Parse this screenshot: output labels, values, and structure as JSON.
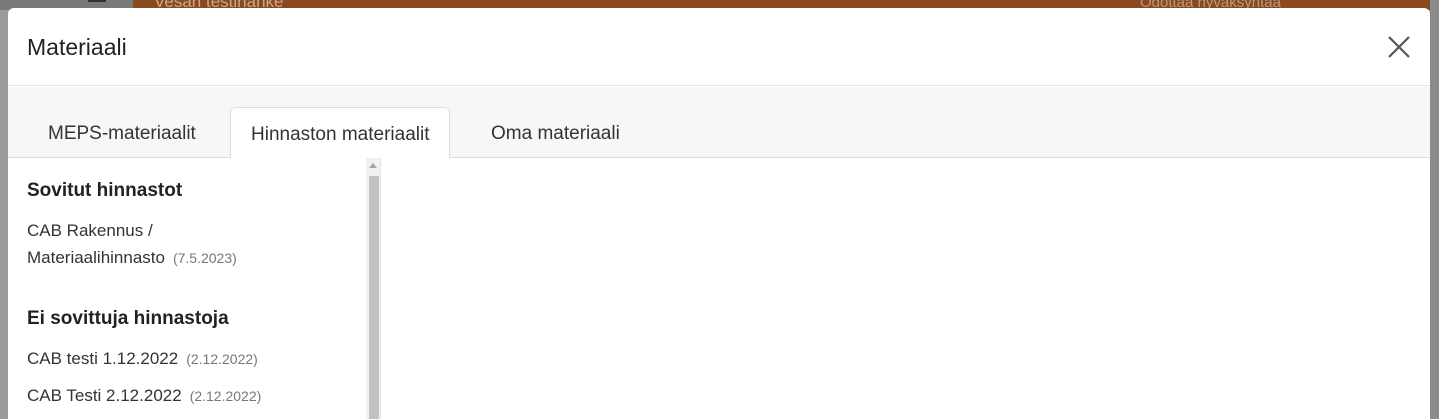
{
  "background": {
    "project_title": "Vesan testihanke",
    "status_text": "Odottaa hyväksyntää"
  },
  "modal": {
    "title": "Materiaali",
    "close_icon": "close-icon"
  },
  "tabs": [
    {
      "label": "MEPS-materiaalit",
      "active": false
    },
    {
      "label": "Hinnaston materiaalit",
      "active": true
    },
    {
      "label": "Oma materiaali",
      "active": false
    }
  ],
  "sidebar": {
    "agreed_title": "Sovitut hinnastot",
    "agreed_items": [
      {
        "line1": "CAB Rakennus /",
        "line2": "Materiaalihinnasto",
        "date": "(7.5.2023)"
      }
    ],
    "not_agreed_title": "Ei sovittuja hinnastoja",
    "not_agreed_items": [
      {
        "name": "CAB testi 1.12.2022",
        "date": "(2.12.2022)"
      },
      {
        "name": "CAB Testi 2.12.2022",
        "date": "(2.12.2022)"
      }
    ]
  }
}
